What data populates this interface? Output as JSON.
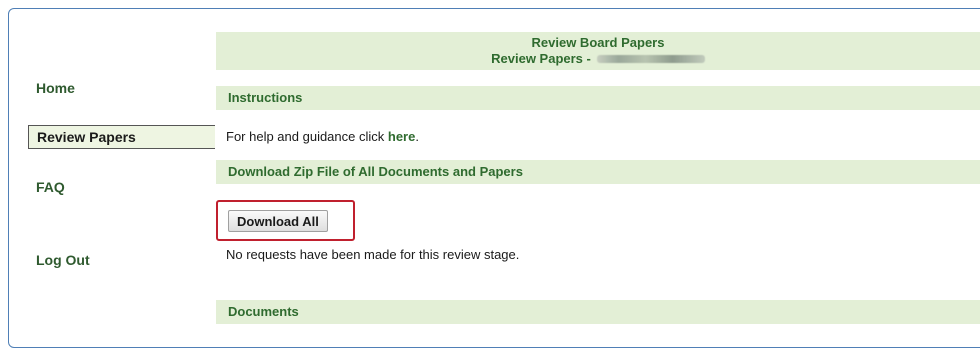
{
  "sidebar": {
    "items": [
      {
        "label": "Home"
      },
      {
        "label": "Review Papers"
      },
      {
        "label": "FAQ"
      },
      {
        "label": "Log Out"
      }
    ]
  },
  "header": {
    "title": "Review Board Papers",
    "subtitle_prefix": "Review Papers  -"
  },
  "sections": {
    "instructions": {
      "title": "Instructions",
      "text": "For help and guidance click ",
      "link": "here",
      "trailing": "."
    },
    "download_zip": {
      "title": "Download Zip File of All Documents and Papers",
      "button_label": "Download All",
      "message": "No requests have been made for this review stage."
    },
    "documents": {
      "title": "Documents"
    }
  },
  "colors": {
    "band_background": "#e3efd6",
    "header_text": "#2f6b2f",
    "highlight_border": "#c0202e",
    "frame_border": "#4f7fb6"
  }
}
